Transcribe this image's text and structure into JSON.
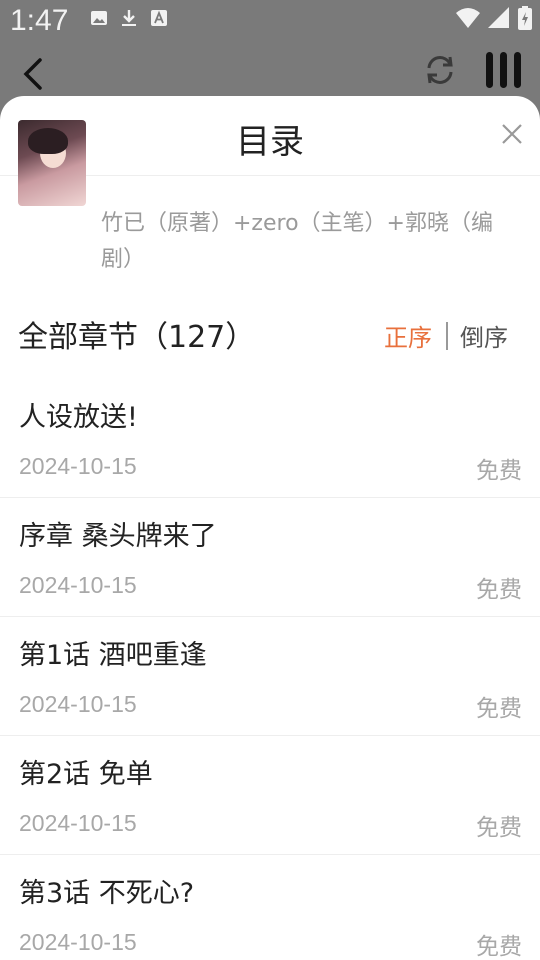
{
  "status_bar": {
    "time": "1:47",
    "icons": [
      "image-icon",
      "download-icon",
      "font-icon",
      "wifi-icon",
      "signal-icon",
      "battery-icon"
    ]
  },
  "app_bar": {
    "icons": [
      "back-icon",
      "refresh-icon",
      "bars-icon"
    ]
  },
  "sheet": {
    "title": "目录",
    "close_icon": "close-icon",
    "authors": "竹已（原著）+zero（主笔）+郭晓（编剧）",
    "chapters_total": "全部章节（127）",
    "sort_asc": "正序",
    "sort_desc": "倒序",
    "accent_color": "#e8703c"
  },
  "chapters": [
    {
      "title": "人设放送!",
      "date": "2024-10-15",
      "price": "免费"
    },
    {
      "title": "序章 桑头牌来了",
      "date": "2024-10-15",
      "price": "免费"
    },
    {
      "title": "第1话 酒吧重逢",
      "date": "2024-10-15",
      "price": "免费"
    },
    {
      "title": "第2话 免单",
      "date": "2024-10-15",
      "price": "免费"
    },
    {
      "title": "第3话 不死心?",
      "date": "2024-10-15",
      "price": "免费"
    }
  ]
}
